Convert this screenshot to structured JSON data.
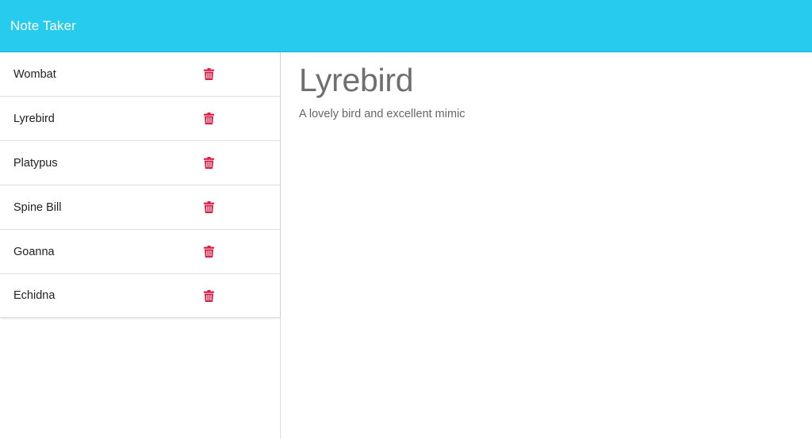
{
  "app": {
    "title": "Note Taker"
  },
  "colors": {
    "navbar": "#27cbee",
    "delete_icon": "#dc143c"
  },
  "notes": [
    {
      "title": "Wombat",
      "icon": "trash-icon"
    },
    {
      "title": "Lyrebird",
      "icon": "trash-icon"
    },
    {
      "title": "Platypus",
      "icon": "trash-icon"
    },
    {
      "title": "Spine Bill",
      "icon": "trash-icon"
    },
    {
      "title": "Goanna",
      "icon": "trash-icon"
    },
    {
      "title": "Echidna",
      "icon": "trash-icon"
    }
  ],
  "active_note": {
    "title": "Lyrebird",
    "text": "A lovely bird and excellent mimic"
  }
}
